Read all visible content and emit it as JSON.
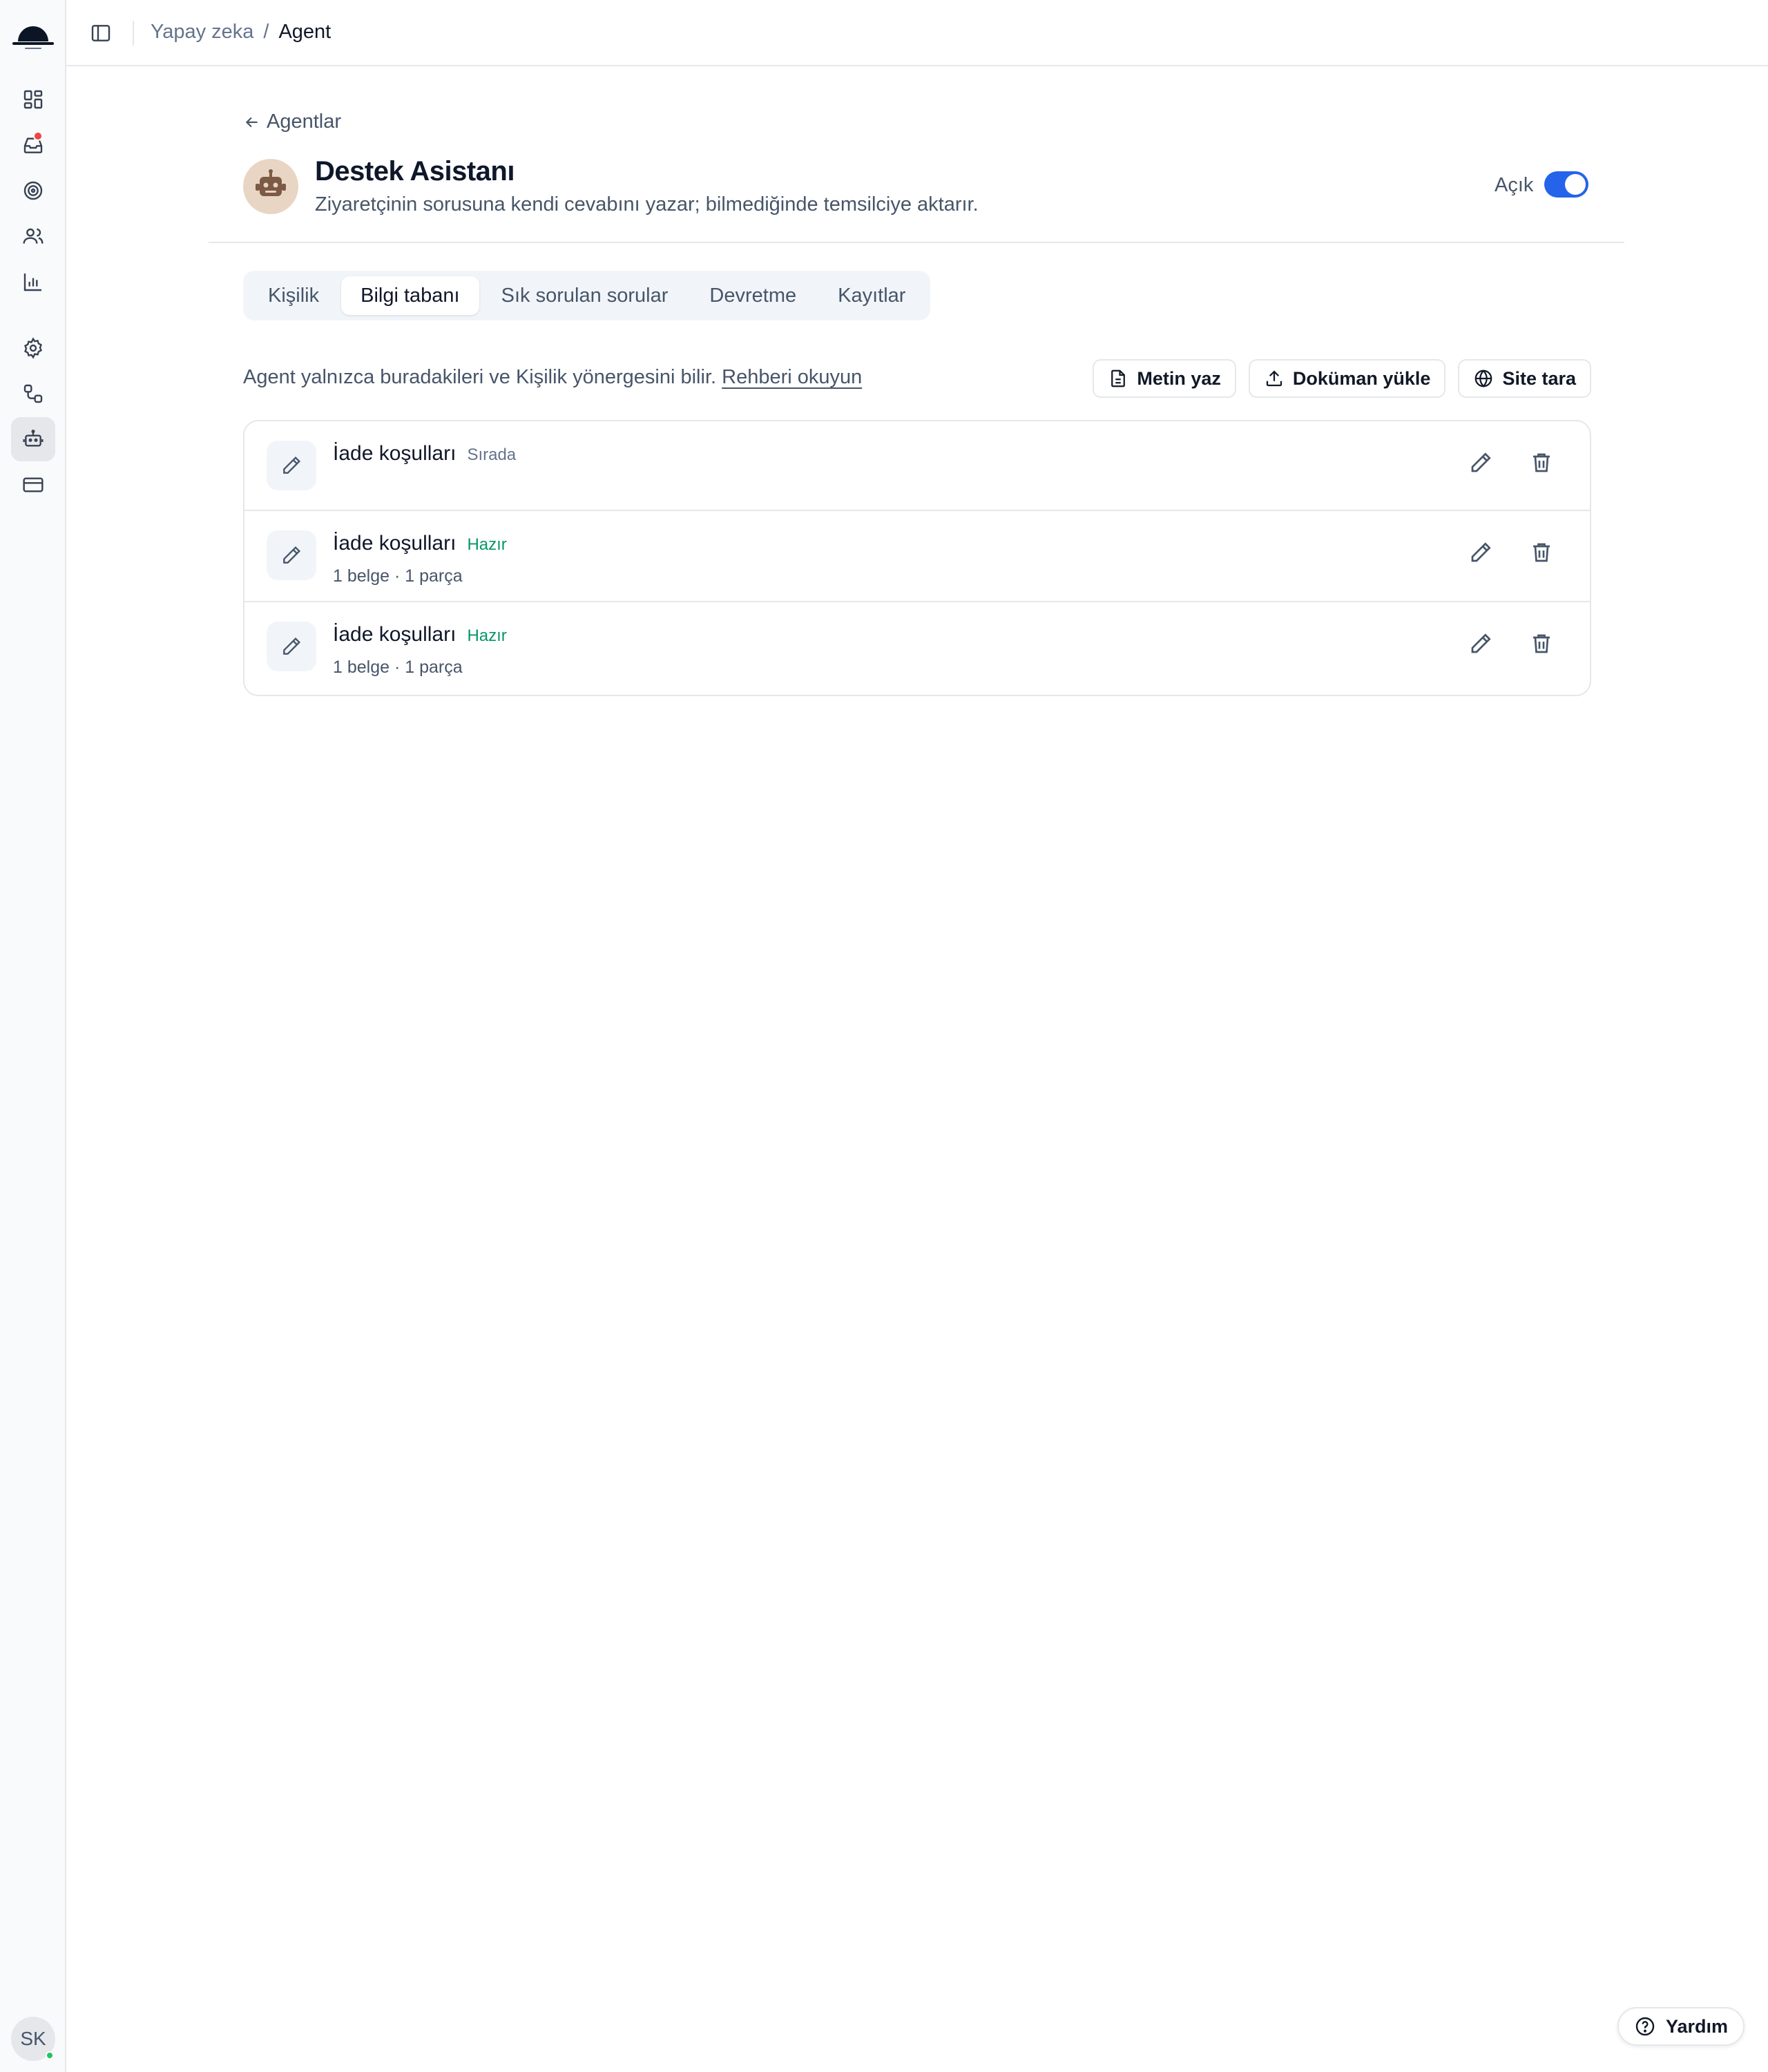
{
  "breadcrumb": {
    "parent": "Yapay zeka",
    "separator": "/",
    "current": "Agent"
  },
  "back_link": "Agentlar",
  "agent": {
    "name": "Destek Asistanı",
    "description": "Ziyaretçinin sorusuna kendi cevabını yazar; bilmediğinde temsilciye aktarır.",
    "status_label": "Açık",
    "enabled": true
  },
  "tabs": [
    {
      "label": "Kişilik",
      "active": false
    },
    {
      "label": "Bilgi tabanı",
      "active": true
    },
    {
      "label": "Sık sorulan sorular",
      "active": false
    },
    {
      "label": "Devretme",
      "active": false
    },
    {
      "label": "Kayıtlar",
      "active": false
    }
  ],
  "info": {
    "text": "Agent yalnızca buradakileri ve Kişilik yönergesini bilir.",
    "link": "Rehberi okuyun"
  },
  "actions": {
    "write_text": "Metin yaz",
    "upload_doc": "Doküman yükle",
    "scan_site": "Site tara"
  },
  "knowledge": [
    {
      "title": "İade koşulları",
      "status": "Sırada",
      "meta": ""
    },
    {
      "title": "İade koşulları",
      "status": "Hazır",
      "meta": "1 belge · 1 parça"
    },
    {
      "title": "İade koşulları",
      "status": "Hazır",
      "meta": "1 belge · 1 parça"
    }
  ],
  "user": {
    "initials": "SK"
  },
  "help": "Yardım",
  "colors": {
    "accent": "#2563eb",
    "ready": "#059669",
    "notification": "#ef4444"
  },
  "icons": {
    "sidebar": [
      "dashboard-icon",
      "inbox-icon",
      "target-icon",
      "users-icon",
      "chart-icon",
      "gear-icon",
      "integrations-icon",
      "bot-icon",
      "card-icon"
    ]
  }
}
